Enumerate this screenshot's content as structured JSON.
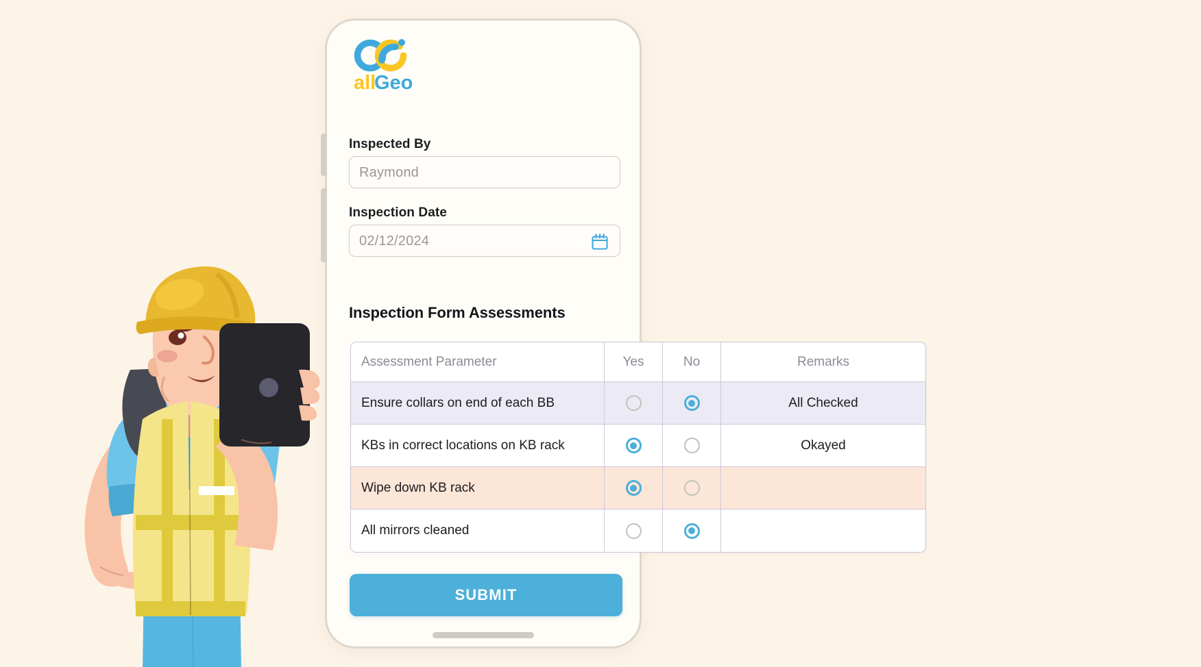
{
  "page": {
    "background_color": "#fdf4e8"
  },
  "brand": {
    "logo_name": "allGeo",
    "logo_text_prefix": "all",
    "logo_text_suffix": "Geo",
    "blue": "#3fa9dd",
    "yellow": "#f9c623"
  },
  "phone": {
    "side_button_volume_up": "volume-up",
    "side_button_volume_down": "volume-down",
    "home_indicator": "home-indicator"
  },
  "form": {
    "inspected_by": {
      "label": "Inspected By",
      "placeholder": "Raymond",
      "value": "Raymond"
    },
    "inspection_date": {
      "label": "Inspection Date",
      "placeholder": "02/12/2024",
      "value": "02/12/2024",
      "icon": "calendar-icon",
      "icon_color": "#3fa9dd"
    },
    "assessments_heading": "Inspection Form Assessments",
    "submit_label": "SUBMIT",
    "submit_color": "#4cb0da"
  },
  "table": {
    "columns": [
      "Assessment Parameter",
      "Yes",
      "No",
      "Remarks"
    ],
    "rows": [
      {
        "parameter": "Ensure collars on end of each BB",
        "yes": false,
        "no": true,
        "remarks": "All Checked",
        "shade": "lavender"
      },
      {
        "parameter": "KBs in correct locations on KB rack",
        "yes": true,
        "no": false,
        "remarks": "Okayed",
        "shade": "white"
      },
      {
        "parameter": "Wipe down KB rack",
        "yes": true,
        "no": false,
        "remarks": "",
        "shade": "peach"
      },
      {
        "parameter": "All mirrors cleaned",
        "yes": false,
        "no": true,
        "remarks": "",
        "shade": "white"
      }
    ],
    "row_shade_colors": {
      "lavender": "#eceaf4",
      "peach": "#fbe6d8",
      "white": "#ffffff"
    },
    "radio_selected_color": "#4ab0d9",
    "radio_unselected_color": "#c4c0bb"
  },
  "illustration": {
    "name": "construction-worker-holding-tablet",
    "hardhat_color": "#e8b930",
    "vest_color": "#f4e58a",
    "shirt_color": "#6ec3e8",
    "pants_color": "#55b6e0",
    "skin_color": "#f9c3a7",
    "tablet_color": "#26262b"
  }
}
